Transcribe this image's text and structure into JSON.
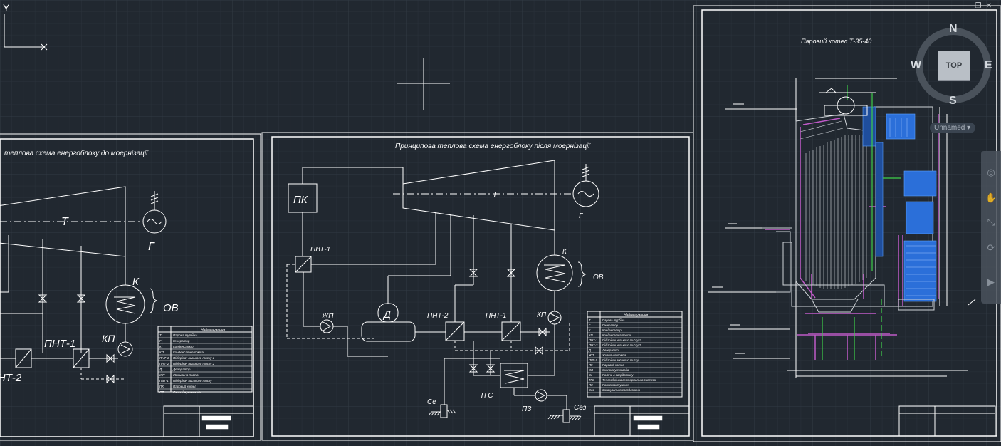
{
  "window": {
    "minimize_label": "–",
    "restore_label": "❐",
    "close_label": "✕"
  },
  "viewcube": {
    "face": "TOP",
    "north": "N",
    "south": "S",
    "east": "E",
    "west": "W",
    "ucs_name": "Unnamed"
  },
  "ucs_icon": {
    "y_label": "Y"
  },
  "sheets": {
    "left": {
      "title": "теплова схема енергоблоку до моернізації",
      "turbine": "Т",
      "generator": "Г",
      "condenser": "К",
      "ov": "ОВ",
      "kp": "КП",
      "pnt1": "ПНТ-1",
      "pnt2": "ПНТ-2",
      "legend_header": "Найменування",
      "legend": [
        [
          "Т",
          "Парова турбіна"
        ],
        [
          "Г",
          "Генератор"
        ],
        [
          "К",
          "Конденсатор"
        ],
        [
          "КП",
          "Конденсатна помпа"
        ],
        [
          "ПНТ-1",
          "Підігрівач низького тиску 1"
        ],
        [
          "ПНТ-2",
          "Підігрівач низького тиску 2"
        ],
        [
          "Д",
          "Деаератор"
        ],
        [
          "ЖП",
          "Живильна помпа"
        ],
        [
          "ПВТ-1",
          "Підігрівач високого тиску"
        ],
        [
          "ПК",
          "Паровий котел"
        ],
        [
          "ОВ",
          "Охолоджуюча вода"
        ]
      ]
    },
    "middle": {
      "title": "Принципова теплова схема енергоблоку після моернізації",
      "pk": "ПК",
      "turbine": "Т",
      "generator": "Г",
      "pvt1": "ПВТ-1",
      "condenser": "К",
      "ov": "ОВ",
      "kp": "КП",
      "zhp": "ЖП",
      "deaerator": "Д",
      "pnt2": "ПНТ-2",
      "pnt1": "ПНТ-1",
      "tgs": "ТГС",
      "pz": "ПЗ",
      "se": "Се",
      "sez": "Сез",
      "legend_header": "Найменування",
      "legend": [
        [
          "Т",
          "Парова турбіна"
        ],
        [
          "Г",
          "Генератор"
        ],
        [
          "К",
          "Конденсатор"
        ],
        [
          "КП",
          "Конденсатна помпа"
        ],
        [
          "ПНТ-1",
          "Підігрівач низького тиску 1"
        ],
        [
          "ПНТ-2",
          "Підігрівач низького тиску 2"
        ],
        [
          "Д",
          "Деаератор"
        ],
        [
          "ЖП",
          "Живильна помпа"
        ],
        [
          "ПВТ-1",
          "Підігрівач високого тиску"
        ],
        [
          "ПК",
          "Паровий котел"
        ],
        [
          "ОВ",
          "Охолоджуюча вода"
        ],
        [
          "Се",
          "Подача в свердловину"
        ],
        [
          "ТГС",
          "Теплообмінна геотермальна система"
        ],
        [
          "ПЗ",
          "Помпа закачування"
        ],
        [
          "Сез",
          "Закачувальна свердловина"
        ]
      ]
    },
    "right": {
      "title": "Паровий котел  Т-35-40"
    }
  }
}
